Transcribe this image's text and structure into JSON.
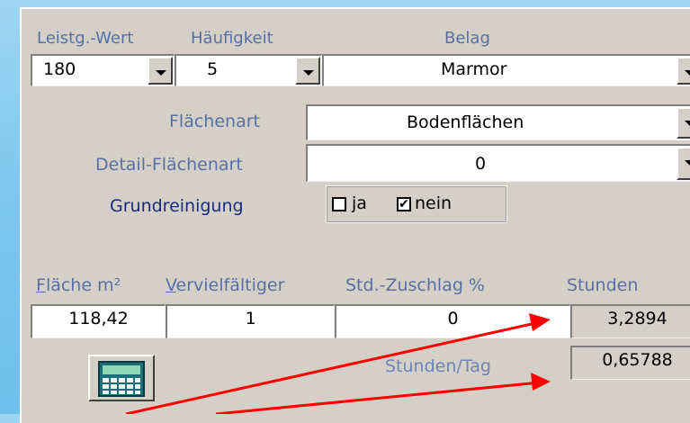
{
  "header": {
    "leistung_label": "Leistg.-Wert",
    "haeufigkeit_label": "Häufigkeit",
    "belag_label": "Belag"
  },
  "selects": {
    "leistung_value": "180",
    "haeufigkeit_value": "5",
    "belag_value": "Marmor",
    "flaechenart_value": "Bodenflächen",
    "detail_value": "0"
  },
  "labels": {
    "flaechenart": "Flächenart",
    "detail_flaechenart": "Detail-Flächenart",
    "grundreinigung": "Grundreinigung"
  },
  "grundreinigung": {
    "ja_label": "ja",
    "nein_label": "nein",
    "ja_checked": false,
    "nein_checked": true,
    "check_mark": "✔"
  },
  "columns": {
    "flaeche_first": "F",
    "flaeche_rest": "läche m²",
    "vervielf_first": "V",
    "vervielf_rest": "ervielfältiger",
    "zuschlag": "Std.-Zuschlag %",
    "stunden": "Stunden"
  },
  "values": {
    "flaeche": "118,42",
    "vervielfaeltiger": "1",
    "zuschlag": "0",
    "stunden": "3,2894",
    "stunden_tag_label": "Stunden/Tag",
    "stunden_tag": "0,65788"
  },
  "icons": {
    "calculator": "calculator-icon"
  },
  "colors": {
    "arrow": "#ff0000",
    "label_blue": "#5b6fa4",
    "dialog_gray": "#d4d0c8"
  }
}
